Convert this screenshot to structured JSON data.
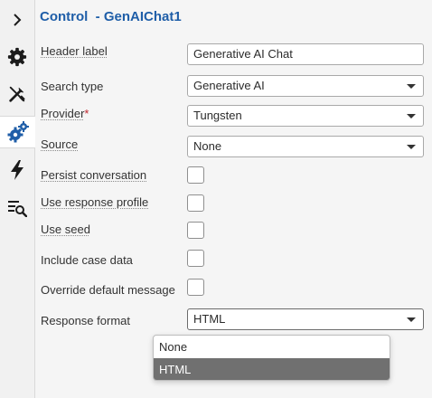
{
  "rail": {
    "items": [
      {
        "icon": "chevron-right-icon"
      },
      {
        "icon": "gear-icon"
      },
      {
        "icon": "tools-icon"
      },
      {
        "icon": "gears-icon",
        "active": true
      },
      {
        "icon": "lightning-icon"
      },
      {
        "icon": "list-search-icon"
      }
    ]
  },
  "panel": {
    "title": "Control  - GenAIChat1",
    "fields": {
      "header_label": {
        "label": "Header label",
        "value": "Generative AI Chat"
      },
      "search_type": {
        "label": "Search type",
        "value": "Generative AI"
      },
      "provider": {
        "label": "Provider",
        "required_mark": "*",
        "value": "Tungsten"
      },
      "source": {
        "label": "Source",
        "value": "None"
      },
      "persist": {
        "label": "Persist conversation",
        "checked": false
      },
      "response_profile": {
        "label": "Use response profile",
        "checked": false
      },
      "use_seed": {
        "label": "Use seed",
        "checked": false
      },
      "case_data": {
        "label": "Include case data",
        "checked": false
      },
      "override_msg": {
        "label": "Override default message",
        "checked": false
      },
      "response_format": {
        "label": "Response format",
        "value": "HTML",
        "options": [
          "None",
          "HTML"
        ]
      }
    }
  },
  "colors": {
    "accent": "#1f5ea8",
    "required": "#c0262d",
    "selected_option_bg": "#707070",
    "icon": "#1b1b1b",
    "active_icon": "#1f5ea8"
  }
}
